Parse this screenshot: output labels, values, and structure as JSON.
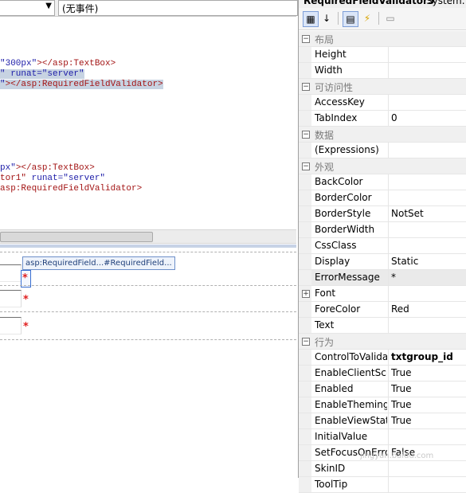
{
  "event_bar": {
    "left_combo_value": "",
    "right_combo_value": "(无事件)"
  },
  "source_code": {
    "block1": {
      "line1_str": "\"300px\"",
      "line1_tag": "></asp:TextBox>",
      "line2": "\" runat=\"server\"",
      "line3_str": "\"",
      "line3_tag": "></asp:RequiredFieldValidator>"
    },
    "block2": {
      "line1_str": "px\"",
      "line1_tag": "></asp:TextBox>",
      "line2_tag": "tor1\"",
      "line2_str": " runat=\"server\"",
      "line3": "asp:RequiredFieldValidator>"
    }
  },
  "design": {
    "smart_tag": "asp:RequiredField...#RequiredField...",
    "validator_marks": [
      "*",
      "*",
      "*"
    ]
  },
  "properties": {
    "title": "RequiredFieldValidator5",
    "type": "System.W",
    "rows": [
      {
        "type": "category",
        "name": "布局"
      },
      {
        "type": "prop",
        "name": "Height",
        "value": ""
      },
      {
        "type": "prop",
        "name": "Width",
        "value": ""
      },
      {
        "type": "category",
        "name": "可访问性"
      },
      {
        "type": "prop",
        "name": "AccessKey",
        "value": ""
      },
      {
        "type": "prop",
        "name": "TabIndex",
        "value": "0"
      },
      {
        "type": "category",
        "name": "数据"
      },
      {
        "type": "prop",
        "name": "(Expressions)",
        "value": ""
      },
      {
        "type": "category",
        "name": "外观"
      },
      {
        "type": "prop",
        "name": "BackColor",
        "value": ""
      },
      {
        "type": "prop",
        "name": "BorderColor",
        "value": ""
      },
      {
        "type": "prop",
        "name": "BorderStyle",
        "value": "NotSet"
      },
      {
        "type": "prop",
        "name": "BorderWidth",
        "value": ""
      },
      {
        "type": "prop",
        "name": "CssClass",
        "value": ""
      },
      {
        "type": "prop",
        "name": "Display",
        "value": "Static"
      },
      {
        "type": "prop",
        "name": "ErrorMessage",
        "value": "*",
        "selected": true
      },
      {
        "type": "prop",
        "name": "Font",
        "value": "",
        "expandable": true
      },
      {
        "type": "prop",
        "name": "ForeColor",
        "value": "Red"
      },
      {
        "type": "prop",
        "name": "Text",
        "value": ""
      },
      {
        "type": "category",
        "name": "行为"
      },
      {
        "type": "prop",
        "name": "ControlToValidate",
        "value": "txtgroup_id",
        "bold": true
      },
      {
        "type": "prop",
        "name": "EnableClientScript",
        "value": "True"
      },
      {
        "type": "prop",
        "name": "Enabled",
        "value": "True"
      },
      {
        "type": "prop",
        "name": "EnableTheming",
        "value": "True"
      },
      {
        "type": "prop",
        "name": "EnableViewState",
        "value": "True"
      },
      {
        "type": "prop",
        "name": "InitialValue",
        "value": ""
      },
      {
        "type": "prop",
        "name": "SetFocusOnError",
        "value": "False"
      },
      {
        "type": "prop",
        "name": "SkinID",
        "value": ""
      },
      {
        "type": "prop",
        "name": "ToolTip",
        "value": ""
      }
    ]
  },
  "watermark": "jingyan.baidu.com",
  "colors": {
    "code_string": "#1c1ca8",
    "code_tag": "#a31515",
    "code_selection": "#c7d3e2",
    "validator_star": "#e02020",
    "category_bg": "#f0f0f0"
  }
}
